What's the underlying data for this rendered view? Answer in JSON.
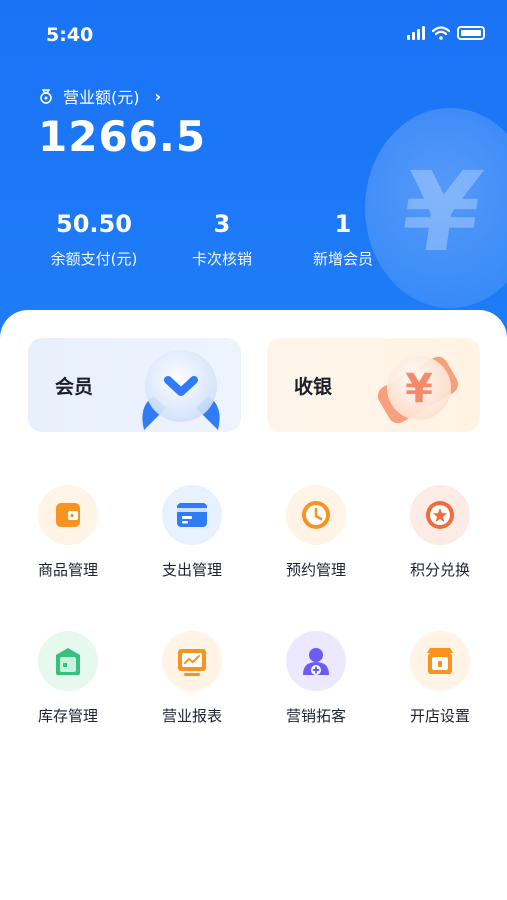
{
  "status_bar": {
    "time": "5:40"
  },
  "header": {
    "revenue_label": "营业额(元)",
    "revenue_value": "1266.5",
    "stats": [
      {
        "value": "50.50",
        "label": "余额支付(元)"
      },
      {
        "value": "3",
        "label": "卡次核销"
      },
      {
        "value": "1",
        "label": "新增会员"
      }
    ]
  },
  "cards": {
    "member_label": "会员",
    "cashier_label": "收银"
  },
  "grid": {
    "items": [
      {
        "label": "商品管理",
        "icon": "product-wallet-icon"
      },
      {
        "label": "支出管理",
        "icon": "expense-card-icon"
      },
      {
        "label": "预约管理",
        "icon": "clock-icon"
      },
      {
        "label": "积分兑换",
        "icon": "star-badge-icon"
      },
      {
        "label": "库存管理",
        "icon": "inventory-house-icon"
      },
      {
        "label": "营业报表",
        "icon": "report-chart-icon"
      },
      {
        "label": "营销拓客",
        "icon": "user-plus-icon"
      },
      {
        "label": "开店设置",
        "icon": "store-icon"
      }
    ]
  },
  "colors": {
    "brand_blue": "#1a73f5",
    "orange": "#f7931e",
    "blue": "#2f7cf6",
    "green": "#35c27f",
    "purple": "#6b5cf6"
  }
}
